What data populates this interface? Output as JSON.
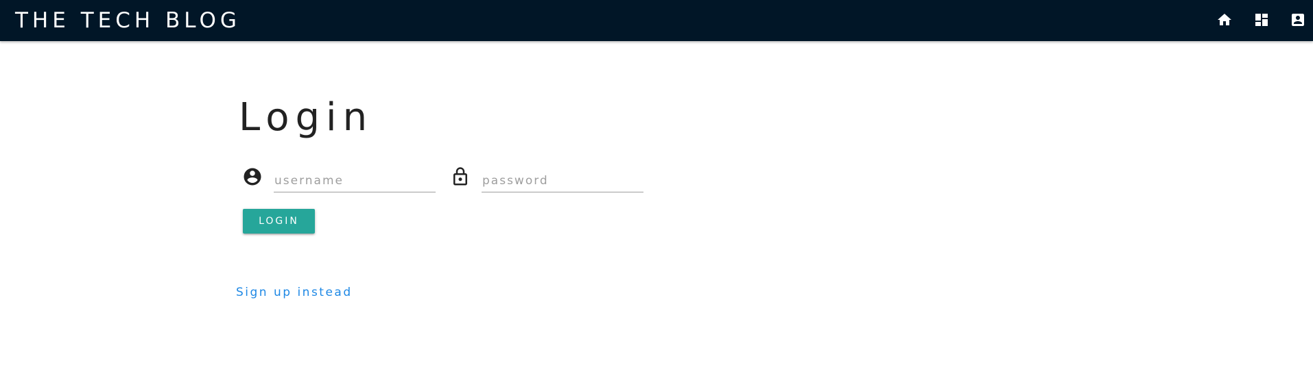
{
  "navbar": {
    "brand": "THE TECH BLOG",
    "background": "#011627",
    "icons": [
      {
        "name": "home-icon"
      },
      {
        "name": "dashboard-icon"
      },
      {
        "name": "account-box-icon"
      }
    ]
  },
  "login": {
    "title": "Login",
    "username": {
      "placeholder": "username",
      "value": "",
      "icon": "account-circle-icon"
    },
    "password": {
      "placeholder": "password",
      "value": "",
      "icon": "lock-icon"
    },
    "submit_label": "LOGIN",
    "submit_color": "#26a69a",
    "signup_link": "Sign up instead",
    "link_color": "#1e88e5"
  }
}
